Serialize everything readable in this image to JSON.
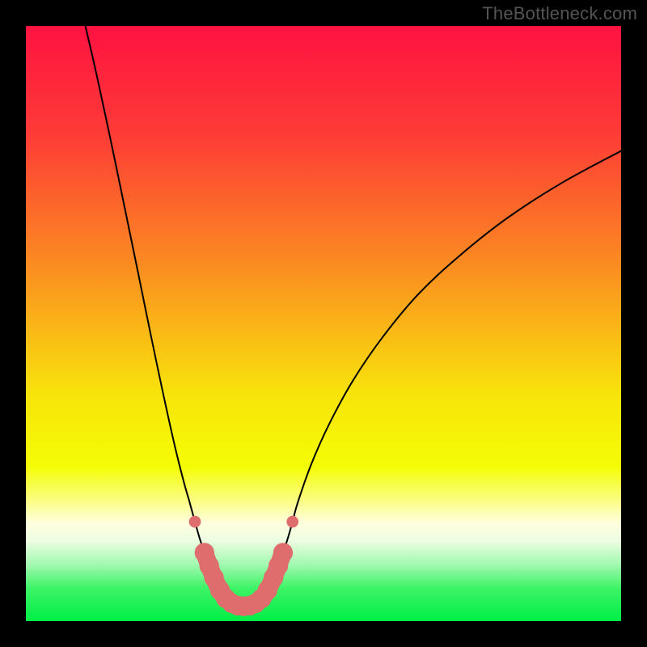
{
  "watermark": "TheBottleneck.com",
  "chart_data": {
    "type": "line",
    "title": "",
    "xlabel": "",
    "ylabel": "",
    "xlim": [
      0,
      100
    ],
    "ylim": [
      0,
      100
    ],
    "legend": false,
    "background_gradient": {
      "stops": [
        {
          "offset": 0.0,
          "color": "#fe1241"
        },
        {
          "offset": 0.18,
          "color": "#fd3b36"
        },
        {
          "offset": 0.4,
          "color": "#fb8b21"
        },
        {
          "offset": 0.62,
          "color": "#f8e40b"
        },
        {
          "offset": 0.74,
          "color": "#f4fd04"
        },
        {
          "offset": 0.8,
          "color": "#fbfd89"
        },
        {
          "offset": 0.835,
          "color": "#fefede"
        },
        {
          "offset": 0.865,
          "color": "#ecfde1"
        },
        {
          "offset": 0.905,
          "color": "#a1f9b0"
        },
        {
          "offset": 0.945,
          "color": "#3df365"
        },
        {
          "offset": 1.0,
          "color": "#01ef47"
        }
      ]
    },
    "series": [
      {
        "name": "bottleneck-curve",
        "stroke": "#000000",
        "stroke_width": 2,
        "points": [
          {
            "x": 10.0,
            "y": 100.0
          },
          {
            "x": 11.5,
            "y": 93.5
          },
          {
            "x": 13.2,
            "y": 85.7
          },
          {
            "x": 15.0,
            "y": 77.2
          },
          {
            "x": 17.0,
            "y": 67.5
          },
          {
            "x": 19.0,
            "y": 57.8
          },
          {
            "x": 21.0,
            "y": 48.0
          },
          {
            "x": 23.0,
            "y": 38.5
          },
          {
            "x": 25.0,
            "y": 29.5
          },
          {
            "x": 26.5,
            "y": 23.5
          },
          {
            "x": 27.5,
            "y": 20.0
          },
          {
            "x": 28.4,
            "y": 16.7
          },
          {
            "x": 29.2,
            "y": 13.9
          },
          {
            "x": 30.0,
            "y": 11.5
          },
          {
            "x": 30.8,
            "y": 9.3
          },
          {
            "x": 31.6,
            "y": 7.3
          },
          {
            "x": 32.6,
            "y": 5.2
          },
          {
            "x": 33.6,
            "y": 3.8
          },
          {
            "x": 34.6,
            "y": 3.0
          },
          {
            "x": 35.6,
            "y": 2.6
          },
          {
            "x": 36.6,
            "y": 2.5
          },
          {
            "x": 37.6,
            "y": 2.6
          },
          {
            "x": 38.6,
            "y": 3.0
          },
          {
            "x": 39.6,
            "y": 3.8
          },
          {
            "x": 40.6,
            "y": 5.2
          },
          {
            "x": 41.6,
            "y": 7.3
          },
          {
            "x": 42.4,
            "y": 9.3
          },
          {
            "x": 43.2,
            "y": 11.5
          },
          {
            "x": 44.0,
            "y": 13.9
          },
          {
            "x": 44.8,
            "y": 16.7
          },
          {
            "x": 45.7,
            "y": 20.0
          },
          {
            "x": 48.0,
            "y": 26.5
          },
          {
            "x": 51.0,
            "y": 33.2
          },
          {
            "x": 55.0,
            "y": 40.5
          },
          {
            "x": 60.0,
            "y": 47.8
          },
          {
            "x": 66.0,
            "y": 55.0
          },
          {
            "x": 73.0,
            "y": 61.5
          },
          {
            "x": 81.0,
            "y": 67.8
          },
          {
            "x": 90.0,
            "y": 73.6
          },
          {
            "x": 100.0,
            "y": 79.0
          }
        ]
      },
      {
        "name": "highlight-left-dot",
        "type": "marker",
        "color": "#e06d6e",
        "cx": 28.4,
        "cy": 16.7,
        "r": 1.0
      },
      {
        "name": "highlight-right-dot",
        "type": "marker",
        "color": "#e06d6e",
        "cx": 44.8,
        "cy": 16.7,
        "r": 1.0
      },
      {
        "name": "highlight-valley",
        "type": "thick-segment",
        "color": "#e06d6e",
        "width": 3.0,
        "points": [
          {
            "x": 30.0,
            "y": 11.5
          },
          {
            "x": 30.8,
            "y": 9.3
          },
          {
            "x": 31.6,
            "y": 7.3
          },
          {
            "x": 32.6,
            "y": 5.2
          },
          {
            "x": 33.6,
            "y": 3.8
          },
          {
            "x": 34.6,
            "y": 3.0
          },
          {
            "x": 35.6,
            "y": 2.6
          },
          {
            "x": 36.6,
            "y": 2.5
          },
          {
            "x": 37.6,
            "y": 2.6
          },
          {
            "x": 38.6,
            "y": 3.0
          },
          {
            "x": 39.6,
            "y": 3.8
          },
          {
            "x": 40.6,
            "y": 5.2
          },
          {
            "x": 41.6,
            "y": 7.3
          },
          {
            "x": 42.4,
            "y": 9.3
          },
          {
            "x": 43.2,
            "y": 11.5
          }
        ]
      }
    ]
  }
}
